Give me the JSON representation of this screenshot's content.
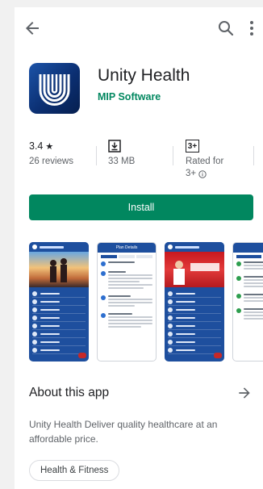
{
  "app": {
    "title": "Unity Health",
    "developer": "MIP Software",
    "icon": "unity-health-logo",
    "colors": {
      "accent": "#01875f",
      "icon_blue": "#0b2f72"
    }
  },
  "toolbar": {
    "back_icon": "arrow-back-icon",
    "search_icon": "search-icon",
    "more_icon": "more-vert-icon"
  },
  "stats": {
    "rating": {
      "value": "3.4",
      "star": "★",
      "sub": "26 reviews"
    },
    "size": {
      "icon": "download-icon",
      "value": "33 MB"
    },
    "content_rating": {
      "icon": "rated-3-plus-icon",
      "badge": "3+",
      "label": "Rated for",
      "sub": "3+",
      "info_icon": "info-icon"
    }
  },
  "install": {
    "label": "Install"
  },
  "screenshots": [
    {
      "title": "",
      "variant": "menu-photo"
    },
    {
      "title": "Plan Details",
      "variant": "details"
    },
    {
      "title": "",
      "variant": "menu-photo-red"
    },
    {
      "title": "",
      "variant": "details"
    }
  ],
  "about": {
    "title": "About this app",
    "arrow_icon": "arrow-forward-icon",
    "description": "Unity Health Deliver quality healthcare at an affordable price."
  },
  "category": {
    "label": "Health & Fitness"
  }
}
